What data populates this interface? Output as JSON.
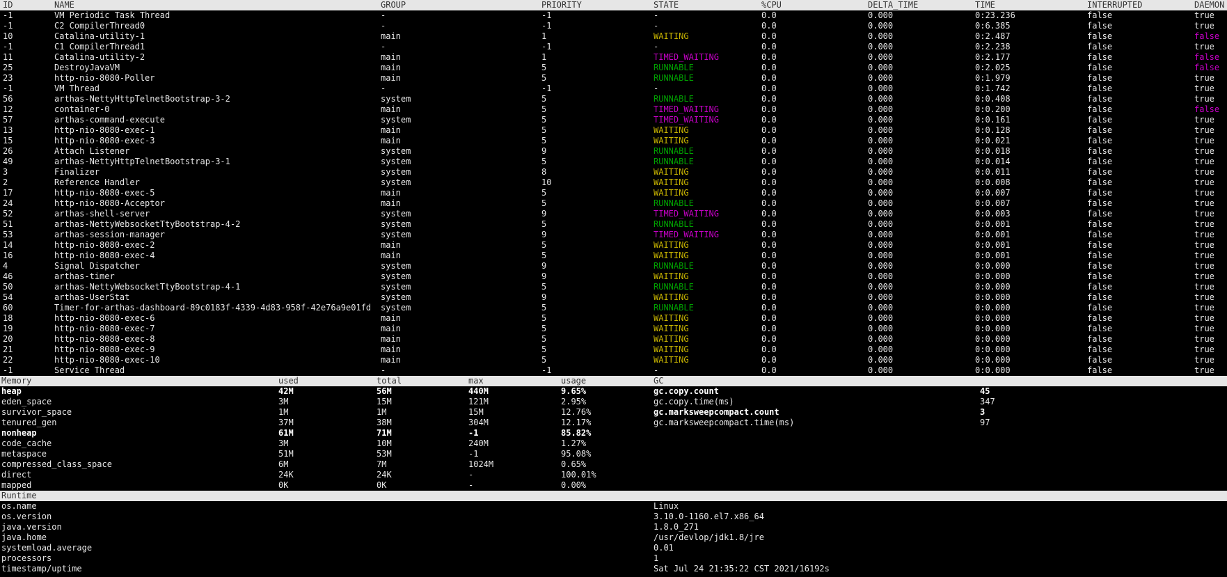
{
  "threads": {
    "headers": [
      "ID",
      "NAME",
      "GROUP",
      "PRIORITY",
      "STATE",
      "%CPU",
      "DELTA_TIME",
      "TIME",
      "INTERRUPTED",
      "DAEMON"
    ],
    "rows": [
      {
        "id": "-1",
        "name": "VM Periodic Task Thread",
        "group": "-",
        "priority": "-1",
        "state": "-",
        "cpu": "0.0",
        "delta": "0.000",
        "time": "0:23.236",
        "interrupted": "false",
        "daemon": "true"
      },
      {
        "id": "-1",
        "name": "C2 CompilerThread0",
        "group": "-",
        "priority": "-1",
        "state": "-",
        "cpu": "0.0",
        "delta": "0.000",
        "time": "0:6.385",
        "interrupted": "false",
        "daemon": "true"
      },
      {
        "id": "10",
        "name": "Catalina-utility-1",
        "group": "main",
        "priority": "1",
        "state": "WAITING",
        "cpu": "0.0",
        "delta": "0.000",
        "time": "0:2.487",
        "interrupted": "false",
        "daemon": "false"
      },
      {
        "id": "-1",
        "name": "C1 CompilerThread1",
        "group": "-",
        "priority": "-1",
        "state": "-",
        "cpu": "0.0",
        "delta": "0.000",
        "time": "0:2.238",
        "interrupted": "false",
        "daemon": "true"
      },
      {
        "id": "11",
        "name": "Catalina-utility-2",
        "group": "main",
        "priority": "1",
        "state": "TIMED_WAITING",
        "cpu": "0.0",
        "delta": "0.000",
        "time": "0:2.177",
        "interrupted": "false",
        "daemon": "false"
      },
      {
        "id": "25",
        "name": "DestroyJavaVM",
        "group": "main",
        "priority": "5",
        "state": "RUNNABLE",
        "cpu": "0.0",
        "delta": "0.000",
        "time": "0:2.025",
        "interrupted": "false",
        "daemon": "false"
      },
      {
        "id": "23",
        "name": "http-nio-8080-Poller",
        "group": "main",
        "priority": "5",
        "state": "RUNNABLE",
        "cpu": "0.0",
        "delta": "0.000",
        "time": "0:1.979",
        "interrupted": "false",
        "daemon": "true"
      },
      {
        "id": "-1",
        "name": "VM Thread",
        "group": "-",
        "priority": "-1",
        "state": "-",
        "cpu": "0.0",
        "delta": "0.000",
        "time": "0:1.742",
        "interrupted": "false",
        "daemon": "true"
      },
      {
        "id": "56",
        "name": "arthas-NettyHttpTelnetBootstrap-3-2",
        "group": "system",
        "priority": "5",
        "state": "RUNNABLE",
        "cpu": "0.0",
        "delta": "0.000",
        "time": "0:0.408",
        "interrupted": "false",
        "daemon": "true"
      },
      {
        "id": "12",
        "name": "container-0",
        "group": "main",
        "priority": "5",
        "state": "TIMED_WAITING",
        "cpu": "0.0",
        "delta": "0.000",
        "time": "0:0.200",
        "interrupted": "false",
        "daemon": "false"
      },
      {
        "id": "57",
        "name": "arthas-command-execute",
        "group": "system",
        "priority": "5",
        "state": "TIMED_WAITING",
        "cpu": "0.0",
        "delta": "0.000",
        "time": "0:0.161",
        "interrupted": "false",
        "daemon": "true"
      },
      {
        "id": "13",
        "name": "http-nio-8080-exec-1",
        "group": "main",
        "priority": "5",
        "state": "WAITING",
        "cpu": "0.0",
        "delta": "0.000",
        "time": "0:0.128",
        "interrupted": "false",
        "daemon": "true"
      },
      {
        "id": "15",
        "name": "http-nio-8080-exec-3",
        "group": "main",
        "priority": "5",
        "state": "WAITING",
        "cpu": "0.0",
        "delta": "0.000",
        "time": "0:0.021",
        "interrupted": "false",
        "daemon": "true"
      },
      {
        "id": "26",
        "name": "Attach Listener",
        "group": "system",
        "priority": "9",
        "state": "RUNNABLE",
        "cpu": "0.0",
        "delta": "0.000",
        "time": "0:0.018",
        "interrupted": "false",
        "daemon": "true"
      },
      {
        "id": "49",
        "name": "arthas-NettyHttpTelnetBootstrap-3-1",
        "group": "system",
        "priority": "5",
        "state": "RUNNABLE",
        "cpu": "0.0",
        "delta": "0.000",
        "time": "0:0.014",
        "interrupted": "false",
        "daemon": "true"
      },
      {
        "id": "3",
        "name": "Finalizer",
        "group": "system",
        "priority": "8",
        "state": "WAITING",
        "cpu": "0.0",
        "delta": "0.000",
        "time": "0:0.011",
        "interrupted": "false",
        "daemon": "true"
      },
      {
        "id": "2",
        "name": "Reference Handler",
        "group": "system",
        "priority": "10",
        "state": "WAITING",
        "cpu": "0.0",
        "delta": "0.000",
        "time": "0:0.008",
        "interrupted": "false",
        "daemon": "true"
      },
      {
        "id": "17",
        "name": "http-nio-8080-exec-5",
        "group": "main",
        "priority": "5",
        "state": "WAITING",
        "cpu": "0.0",
        "delta": "0.000",
        "time": "0:0.007",
        "interrupted": "false",
        "daemon": "true"
      },
      {
        "id": "24",
        "name": "http-nio-8080-Acceptor",
        "group": "main",
        "priority": "5",
        "state": "RUNNABLE",
        "cpu": "0.0",
        "delta": "0.000",
        "time": "0:0.007",
        "interrupted": "false",
        "daemon": "true"
      },
      {
        "id": "52",
        "name": "arthas-shell-server",
        "group": "system",
        "priority": "9",
        "state": "TIMED_WAITING",
        "cpu": "0.0",
        "delta": "0.000",
        "time": "0:0.003",
        "interrupted": "false",
        "daemon": "true"
      },
      {
        "id": "51",
        "name": "arthas-NettyWebsocketTtyBootstrap-4-2",
        "group": "system",
        "priority": "5",
        "state": "RUNNABLE",
        "cpu": "0.0",
        "delta": "0.000",
        "time": "0:0.001",
        "interrupted": "false",
        "daemon": "true"
      },
      {
        "id": "53",
        "name": "arthas-session-manager",
        "group": "system",
        "priority": "9",
        "state": "TIMED_WAITING",
        "cpu": "0.0",
        "delta": "0.000",
        "time": "0:0.001",
        "interrupted": "false",
        "daemon": "true"
      },
      {
        "id": "14",
        "name": "http-nio-8080-exec-2",
        "group": "main",
        "priority": "5",
        "state": "WAITING",
        "cpu": "0.0",
        "delta": "0.000",
        "time": "0:0.001",
        "interrupted": "false",
        "daemon": "true"
      },
      {
        "id": "16",
        "name": "http-nio-8080-exec-4",
        "group": "main",
        "priority": "5",
        "state": "WAITING",
        "cpu": "0.0",
        "delta": "0.000",
        "time": "0:0.001",
        "interrupted": "false",
        "daemon": "true"
      },
      {
        "id": "4",
        "name": "Signal Dispatcher",
        "group": "system",
        "priority": "9",
        "state": "RUNNABLE",
        "cpu": "0.0",
        "delta": "0.000",
        "time": "0:0.000",
        "interrupted": "false",
        "daemon": "true"
      },
      {
        "id": "46",
        "name": "arthas-timer",
        "group": "system",
        "priority": "9",
        "state": "WAITING",
        "cpu": "0.0",
        "delta": "0.000",
        "time": "0:0.000",
        "interrupted": "false",
        "daemon": "true"
      },
      {
        "id": "50",
        "name": "arthas-NettyWebsocketTtyBootstrap-4-1",
        "group": "system",
        "priority": "5",
        "state": "RUNNABLE",
        "cpu": "0.0",
        "delta": "0.000",
        "time": "0:0.000",
        "interrupted": "false",
        "daemon": "true"
      },
      {
        "id": "54",
        "name": "arthas-UserStat",
        "group": "system",
        "priority": "9",
        "state": "WAITING",
        "cpu": "0.0",
        "delta": "0.000",
        "time": "0:0.000",
        "interrupted": "false",
        "daemon": "true"
      },
      {
        "id": "60",
        "name": "Timer-for-arthas-dashboard-89c0183f-4339-4d83-958f-42e76a9e01fd",
        "group": "system",
        "priority": "5",
        "state": "RUNNABLE",
        "cpu": "0.0",
        "delta": "0.000",
        "time": "0:0.000",
        "interrupted": "false",
        "daemon": "true"
      },
      {
        "id": "18",
        "name": "http-nio-8080-exec-6",
        "group": "main",
        "priority": "5",
        "state": "WAITING",
        "cpu": "0.0",
        "delta": "0.000",
        "time": "0:0.000",
        "interrupted": "false",
        "daemon": "true"
      },
      {
        "id": "19",
        "name": "http-nio-8080-exec-7",
        "group": "main",
        "priority": "5",
        "state": "WAITING",
        "cpu": "0.0",
        "delta": "0.000",
        "time": "0:0.000",
        "interrupted": "false",
        "daemon": "true"
      },
      {
        "id": "20",
        "name": "http-nio-8080-exec-8",
        "group": "main",
        "priority": "5",
        "state": "WAITING",
        "cpu": "0.0",
        "delta": "0.000",
        "time": "0:0.000",
        "interrupted": "false",
        "daemon": "true"
      },
      {
        "id": "21",
        "name": "http-nio-8080-exec-9",
        "group": "main",
        "priority": "5",
        "state": "WAITING",
        "cpu": "0.0",
        "delta": "0.000",
        "time": "0:0.000",
        "interrupted": "false",
        "daemon": "true"
      },
      {
        "id": "22",
        "name": "http-nio-8080-exec-10",
        "group": "main",
        "priority": "5",
        "state": "WAITING",
        "cpu": "0.0",
        "delta": "0.000",
        "time": "0:0.000",
        "interrupted": "false",
        "daemon": "true"
      },
      {
        "id": "-1",
        "name": "Service Thread",
        "group": "-",
        "priority": "-1",
        "state": "-",
        "cpu": "0.0",
        "delta": "0.000",
        "time": "0:0.000",
        "interrupted": "false",
        "daemon": "true"
      }
    ]
  },
  "memory": {
    "headers": [
      "Memory",
      "used",
      "total",
      "max",
      "usage"
    ],
    "rows": [
      {
        "name": "heap",
        "used": "42M",
        "total": "56M",
        "max": "440M",
        "usage": "9.65%",
        "bold": true
      },
      {
        "name": "eden_space",
        "used": "3M",
        "total": "15M",
        "max": "121M",
        "usage": "2.95%"
      },
      {
        "name": "survivor_space",
        "used": "1M",
        "total": "1M",
        "max": "15M",
        "usage": "12.76%"
      },
      {
        "name": "tenured_gen",
        "used": "37M",
        "total": "38M",
        "max": "304M",
        "usage": "12.17%"
      },
      {
        "name": "nonheap",
        "used": "61M",
        "total": "71M",
        "max": "-1",
        "usage": "85.82%",
        "bold": true
      },
      {
        "name": "code_cache",
        "used": "3M",
        "total": "10M",
        "max": "240M",
        "usage": "1.27%"
      },
      {
        "name": "metaspace",
        "used": "51M",
        "total": "53M",
        "max": "-1",
        "usage": "95.08%"
      },
      {
        "name": "compressed_class_space",
        "used": "6M",
        "total": "7M",
        "max": "1024M",
        "usage": "0.65%"
      },
      {
        "name": "direct",
        "used": "24K",
        "total": "24K",
        "max": "-",
        "usage": "100.01%"
      },
      {
        "name": "mapped",
        "used": "0K",
        "total": "0K",
        "max": "-",
        "usage": "0.00%"
      }
    ]
  },
  "gc": {
    "header": "GC",
    "rows": [
      {
        "name": "gc.copy.count",
        "value": "45",
        "bold": true
      },
      {
        "name": "gc.copy.time(ms)",
        "value": "347"
      },
      {
        "name": "gc.marksweepcompact.count",
        "value": "3",
        "bold": true
      },
      {
        "name": "gc.marksweepcompact.time(ms)",
        "value": "97"
      }
    ]
  },
  "runtime": {
    "header": "Runtime",
    "rows": [
      {
        "name": "os.name",
        "value": "Linux"
      },
      {
        "name": "os.version",
        "value": "3.10.0-1160.el7.x86_64"
      },
      {
        "name": "java.version",
        "value": "1.8.0_271"
      },
      {
        "name": "java.home",
        "value": "/usr/devlop/jdk1.8/jre"
      },
      {
        "name": "systemload.average",
        "value": "0.01"
      },
      {
        "name": "processors",
        "value": "1"
      },
      {
        "name": "timestamp/uptime",
        "value": "Sat Jul 24 21:35:22 CST 2021/16192s"
      }
    ]
  },
  "colors": {
    "background": "#000000",
    "text": "#e6e6e6",
    "header_bg": "#e6e6e6",
    "header_text": "#333333",
    "state_waiting": "#c8b400",
    "state_timed_waiting": "#c800c8",
    "state_runnable": "#00a000",
    "daemon_false": "#c800c8"
  }
}
